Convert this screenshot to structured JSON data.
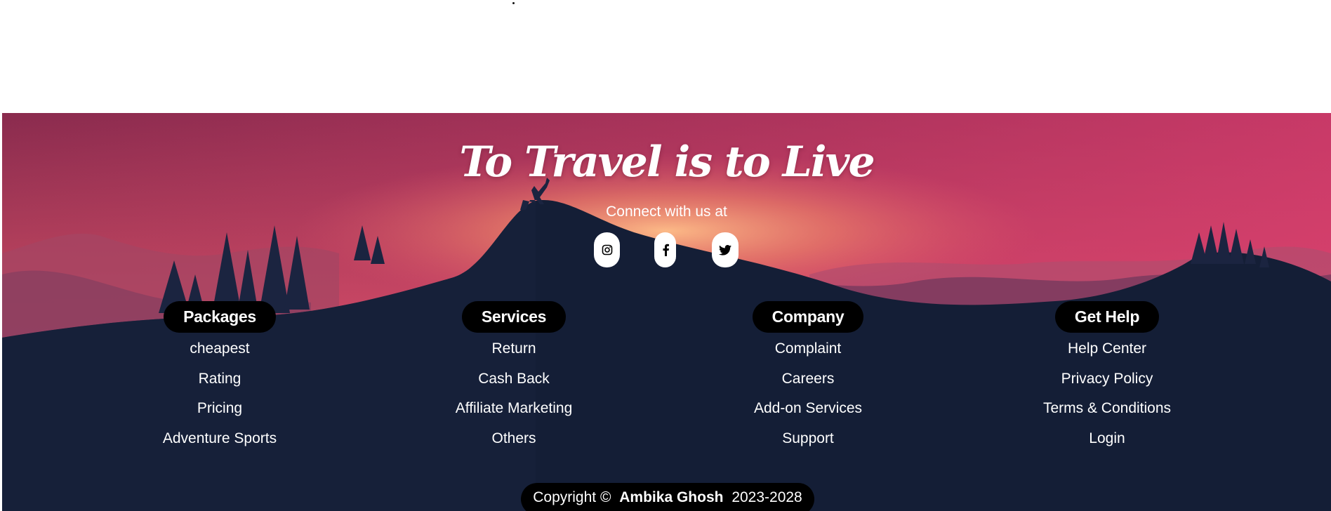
{
  "footer": {
    "tagline": "To Travel is to Live",
    "connect_text": "Connect with us at",
    "social": [
      {
        "icon": "instagram-icon"
      },
      {
        "icon": "facebook-icon"
      },
      {
        "icon": "twitter-icon"
      }
    ],
    "columns": [
      {
        "heading": "Packages",
        "links": [
          "cheapest",
          "Rating",
          "Pricing",
          "Adventure Sports"
        ]
      },
      {
        "heading": "Services",
        "links": [
          "Return",
          "Cash Back",
          "Affiliate Marketing",
          "Others"
        ]
      },
      {
        "heading": "Company",
        "links": [
          "Complaint",
          "Careers",
          "Add-on Services",
          "Support"
        ]
      },
      {
        "heading": "Get Help",
        "links": [
          "Help Center",
          "Privacy Policy",
          "Terms & Conditions",
          "Login"
        ]
      }
    ],
    "copyright": {
      "prefix": "Copyright ©",
      "author": "Ambika Ghosh",
      "years": "2023-2028"
    }
  },
  "colors": {
    "sky_top": "#8e2d4d",
    "sky_glow": "#f7a36e",
    "sky_right": "#d9426e",
    "mountain": "#141e36",
    "pill": "#000000",
    "text": "#ffffff"
  }
}
